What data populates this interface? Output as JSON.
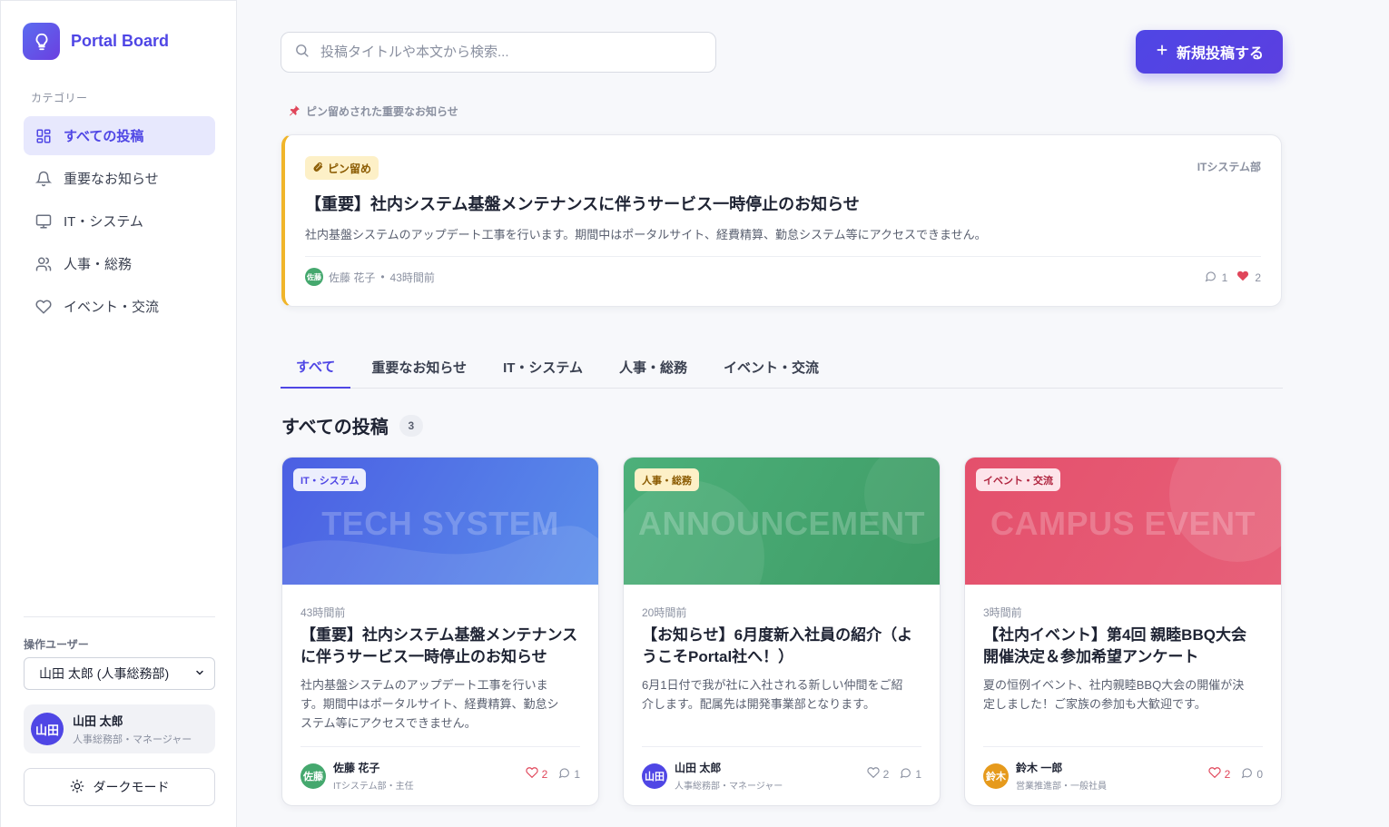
{
  "brand": {
    "name": "Portal Board",
    "icon": "lightbulb-icon"
  },
  "sidebar": {
    "category_label": "カテゴリー",
    "items": [
      {
        "label": "すべての投稿",
        "icon": "grid-icon",
        "active": true
      },
      {
        "label": "重要なお知らせ",
        "icon": "bell-icon",
        "active": false
      },
      {
        "label": "IT・システム",
        "icon": "monitor-icon",
        "active": false
      },
      {
        "label": "人事・総務",
        "icon": "users-icon",
        "active": false
      },
      {
        "label": "イベント・交流",
        "icon": "heart-icon",
        "active": false
      }
    ],
    "operator_label": "操作ユーザー",
    "operator_select": "山田 太郎 (人事総務部)",
    "current_user": {
      "avatar": "山田",
      "name": "山田 太郎",
      "role": "人事総務部・マネージャー"
    },
    "dark_mode_label": "ダークモード"
  },
  "search": {
    "placeholder": "投稿タイトルや本文から検索..."
  },
  "new_post_label": "新規投稿する",
  "pinned": {
    "section_label": "ピン留めされた重要なお知らせ",
    "badge": "ピン留め",
    "dept": "ITシステム部",
    "title": "【重要】社内システム基盤メンテナンスに伴うサービス一時停止のお知らせ",
    "excerpt": "社内基盤システムのアップデート工事を行います。期間中はポータルサイト、経費精算、勤怠システム等にアクセスできません。",
    "author_avatar": "佐藤",
    "author": "佐藤 花子",
    "time": "43時間前",
    "comments": "1",
    "likes": "2"
  },
  "tabs": [
    "すべて",
    "重要なお知らせ",
    "IT・システム",
    "人事・総務",
    "イベント・交流"
  ],
  "section": {
    "title": "すべての投稿",
    "count": "3"
  },
  "posts": [
    {
      "category": "IT・システム",
      "watermark": "TECH SYSTEM",
      "time": "43時間前",
      "title": "【重要】社内システム基盤メンテナンスに伴うサービス一時停止のお知らせ",
      "excerpt": "社内基盤システムのアップデート工事を行います。期間中はポータルサイト、経費精算、勤怠システム等にアクセスできません。",
      "author_avatar": "佐藤",
      "author": "佐藤 花子",
      "author_role": "ITシステム部・主任",
      "likes": "2",
      "comments": "1"
    },
    {
      "category": "人事・総務",
      "watermark": "ANNOUNCEMENT",
      "time": "20時間前",
      "title": "【お知らせ】6月度新入社員の紹介（ようこそPortal社へ！）",
      "excerpt": "6月1日付で我が社に入社される新しい仲間をご紹介します。配属先は開発事業部となります。",
      "author_avatar": "山田",
      "author": "山田 太郎",
      "author_role": "人事総務部・マネージャー",
      "likes": "2",
      "comments": "1"
    },
    {
      "category": "イベント・交流",
      "watermark": "CAMPUS EVENT",
      "time": "3時間前",
      "title": "【社内イベント】第4回 親睦BBQ大会 開催決定＆参加希望アンケート",
      "excerpt": "夏の恒例イベント、社内親睦BBQ大会の開催が決定しました！ご家族の参加も大歓迎です。",
      "author_avatar": "鈴木",
      "author": "鈴木 一郎",
      "author_role": "営業推進部・一般社員",
      "likes": "2",
      "comments": "0"
    }
  ],
  "colors": {
    "accent": "#4f46e5",
    "pin": "#f0b52a",
    "it": "#4f6cec",
    "hr": "#45a86e",
    "event": "#e55170"
  }
}
